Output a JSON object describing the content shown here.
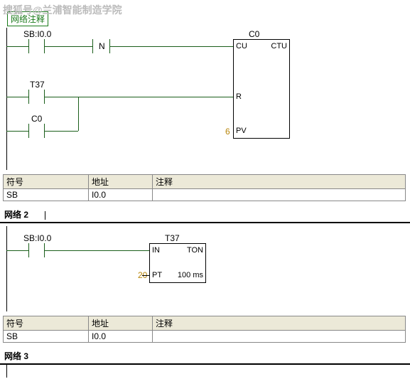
{
  "watermark": "搜狐号@兰浦智能制造学院",
  "network1": {
    "title": "网络注释",
    "sb_label": "SB:I0.0",
    "n_label": "N",
    "t37_label": "T37",
    "c0_label": "C0",
    "box": {
      "title": "C0",
      "in1": "CU",
      "type": "CTU",
      "in2": "R",
      "in3": "PV",
      "pv_val": "6"
    }
  },
  "table": {
    "h1": "符号",
    "h2": "地址",
    "h3": "注释",
    "r1c1": "SB",
    "r1c2": "I0.0",
    "r1c3": ""
  },
  "network2": {
    "header": "网络 2",
    "sb_label": "SB:I0.0",
    "box": {
      "title": "T37",
      "in1": "IN",
      "type": "TON",
      "in2": "PT",
      "pt_val": "20",
      "timebase": "100 ms"
    }
  },
  "network3": {
    "header": "网络 3"
  }
}
